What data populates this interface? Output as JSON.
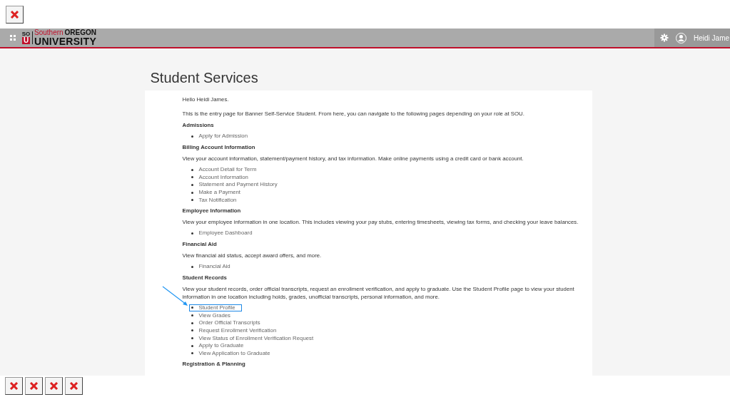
{
  "header": {
    "logo": {
      "mark_top": "SO",
      "mark_bottom": "U",
      "line1_red": "Southern",
      "line1": "OREGON",
      "line2": "UNIVERSITY"
    },
    "user_name": "Heidi Jame"
  },
  "page_title": "Student Services",
  "greeting": "Hello Heidi James.",
  "intro": "This is the entry page for Banner Self-Service Student. From here, you can navigate to the following pages depending on your role at SOU.",
  "sections": [
    {
      "heading": "Admissions",
      "links": [
        {
          "label": "Apply for Admission",
          "highlighted": false
        }
      ]
    },
    {
      "heading": "Billing Account Information",
      "description": "View your account information, statement/payment history, and tax information. Make online payments using a credit card or bank account.",
      "links": [
        {
          "label": "Account Detail for Term",
          "highlighted": false
        },
        {
          "label": "Account Information",
          "highlighted": false
        },
        {
          "label": "Statement and Payment History",
          "highlighted": false
        },
        {
          "label": "Make a Payment",
          "highlighted": false
        },
        {
          "label": "Tax Notification",
          "highlighted": false
        }
      ]
    },
    {
      "heading": "Employee Information",
      "description": "View your employee information in one location. This includes viewing your pay stubs, entering timesheets, viewing tax forms, and checking your leave balances.",
      "links": [
        {
          "label": "Employee Dashboard",
          "highlighted": false
        }
      ]
    },
    {
      "heading": "Financial Aid",
      "description": "View financial aid status, accept award offers, and more.",
      "links": [
        {
          "label": "Financial Aid",
          "highlighted": false
        }
      ]
    },
    {
      "heading": "Student Records",
      "description": "View your student records, order official transcripts, request an enrollment verification, and apply to graduate. Use the Student Profile page to view your student information in one location including holds, grades, unofficial transcripts, personal information, and more.",
      "links": [
        {
          "label": "Student Profile",
          "highlighted": true
        },
        {
          "label": "View Grades",
          "highlighted": false
        },
        {
          "label": "Order Official Transcripts",
          "highlighted": false
        },
        {
          "label": "Request Enrollment Verification",
          "highlighted": false
        },
        {
          "label": "View Status of Enrollment Verification Request",
          "highlighted": false
        },
        {
          "label": "Apply to Graduate",
          "highlighted": false
        },
        {
          "label": "View Application to Graduate",
          "highlighted": false
        }
      ]
    },
    {
      "heading": "Registration & Planning"
    }
  ]
}
